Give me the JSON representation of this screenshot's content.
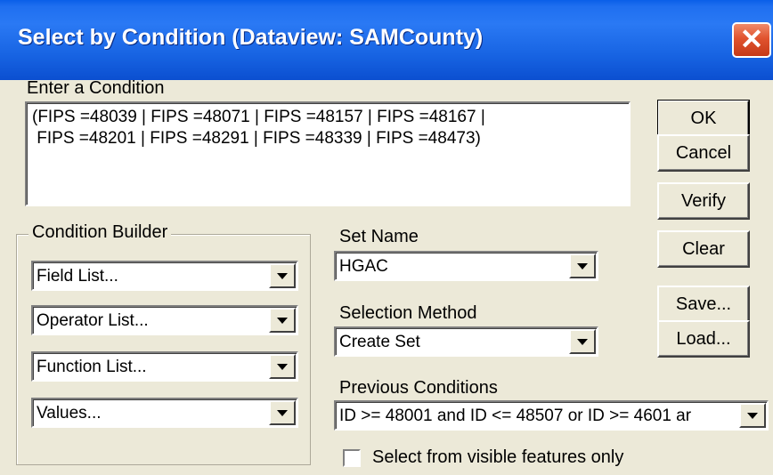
{
  "window": {
    "title": "Select by Condition (Dataview: SAMCounty)",
    "close_glyph": "✕"
  },
  "condition": {
    "label": "Enter a Condition",
    "lines": [
      "(FIPS =48039 | FIPS =48071 | FIPS =48157 | FIPS =48167 |",
      " FIPS =48201 | FIPS =48291 | FIPS =48339 | FIPS =48473)"
    ]
  },
  "buttons": {
    "ok": "OK",
    "cancel": "Cancel",
    "verify": "Verify",
    "clear": "Clear",
    "save": "Save...",
    "load": "Load..."
  },
  "builder": {
    "label": "Condition Builder",
    "field_list": "Field List...",
    "operator_list": "Operator List...",
    "function_list": "Function List...",
    "values": "Values..."
  },
  "set_name": {
    "label": "Set Name",
    "value": "HGAC"
  },
  "selection_method": {
    "label": "Selection Method",
    "value": "Create Set"
  },
  "previous_conditions": {
    "label": "Previous Conditions",
    "value": "ID >= 48001 and ID <= 48507 or ID >= 4601 ar"
  },
  "visible_only": {
    "label": "Select from visible features only",
    "checked": false
  }
}
